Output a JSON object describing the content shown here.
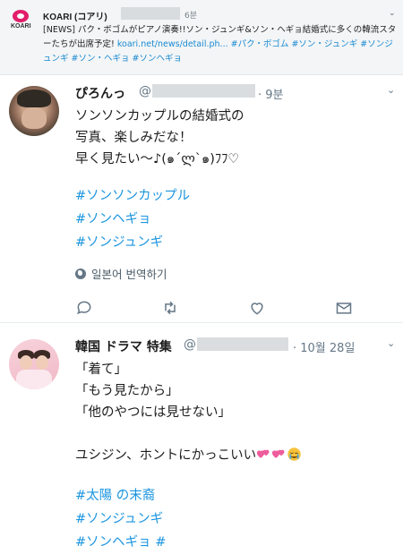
{
  "top": {
    "account_name": "KOARI (コアリ)",
    "time": "6분",
    "logo_text": "KOARI",
    "text_plain": "[NEWS] パク・ボゴムがピアノ演奏!!ソン・ジュンギ&ソン・ヘギョ結婚式に多くの韓流スターたちが出席予定!",
    "link": "koari.net/news/detail.ph...",
    "hashtags_inline": "#パク・ボゴム #ソン・ジュンギ #ソンジュンギ #ソン・ヘギョ #ソンヘギョ"
  },
  "tweet1": {
    "name": "ぴろんっ",
    "at": "@",
    "time": "· 9분",
    "text": "ソンソンカップルの結婚式の\n写真、楽しみだな！\n早く見たい～♪(๑´ლ`๑)ﾌﾌ♡",
    "hashtags": [
      "#ソンソンカップル",
      "#ソンヘギョ",
      "#ソンジュンギ"
    ],
    "translate_label": "일본어 번역하기"
  },
  "tweet2": {
    "name": "韓国 ドラマ 特集",
    "at": "@",
    "time": "· 10월 28일",
    "text": "「着て」\n「もう見たから」\n「他のやつには見せない」\n\nユシジン、ホントにかっこいい",
    "hashtags": [
      "#太陽 の末裔",
      "#ソンジュンギ",
      "#ソンヘギョ #"
    ]
  },
  "icons": [
    "reply-icon",
    "retweet-icon",
    "like-icon",
    "message-icon",
    "globe-icon",
    "chevron-down-icon",
    "heart-emoji-icon",
    "crying-emoji-icon"
  ],
  "colors": {
    "link": "#1b95e0",
    "muted": "#657786",
    "koari": "#e21d6a"
  }
}
